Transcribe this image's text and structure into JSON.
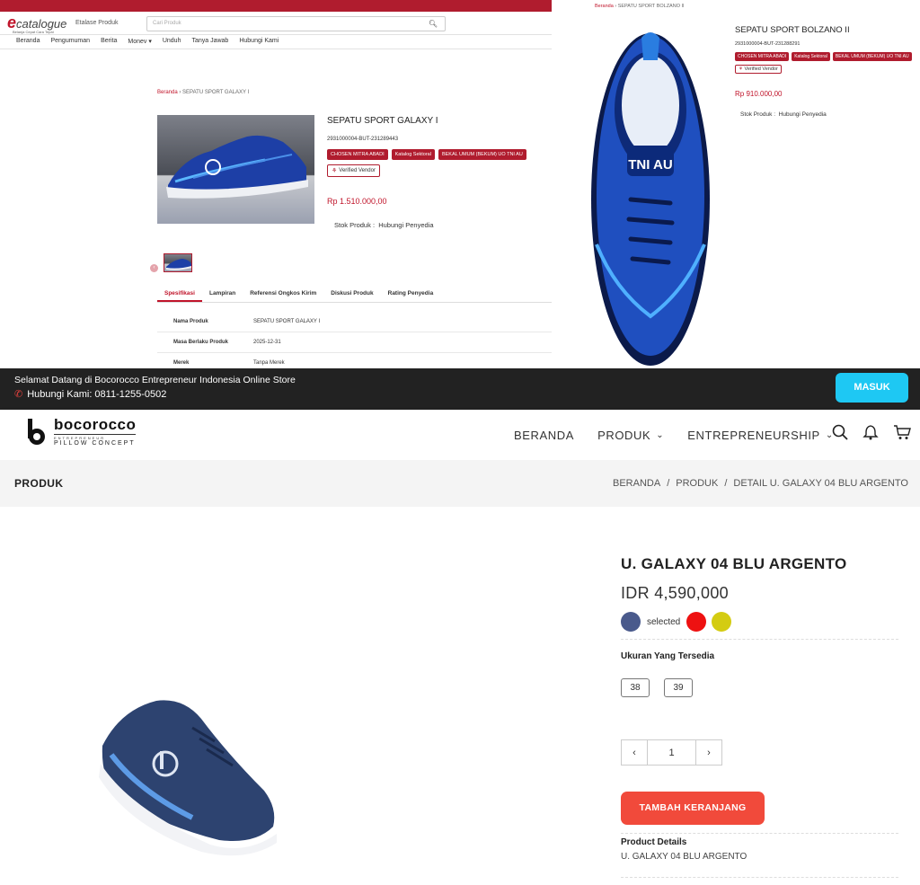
{
  "ecatalogue": {
    "logo": {
      "e": "e",
      "text": "catalogue",
      "sub": "Belanja Cepat Cara Tepat"
    },
    "etalase_label": "Etalase Produk",
    "search_placeholder": "Cari Produk",
    "nav": [
      "Beranda",
      "Pengumuman",
      "Berita",
      "Monev ▾",
      "Unduh",
      "Tanya Jawab",
      "Hubungi Kami"
    ],
    "breadcrumb": {
      "home": "Beranda",
      "sep": "›",
      "current": "SEPATU SPORT GALAXY I"
    },
    "product": {
      "title": "SEPATU SPORT GALAXY I",
      "sku": "2931000004-BUT-231289443",
      "badges": [
        "CHOSEN MITRA ABADI",
        "Katalog Sektoral",
        "BEKAL UMUM (BEKUM) UO TNI AU"
      ],
      "verified": "Verified Vendor",
      "price": "Rp 1.510.000,00",
      "stock_label": "Stok Produk :",
      "stock_value": "Hubungi Penyedia"
    },
    "tabs": [
      "Spesifikasi",
      "Lampiran",
      "Referensi Ongkos Kirim",
      "Diskusi Produk",
      "Rating Penyedia"
    ],
    "specs": [
      {
        "k": "Nama Produk",
        "v": "SEPATU SPORT GALAXY I"
      },
      {
        "k": "Masa Berlaku Produk",
        "v": "2025-12-31"
      },
      {
        "k": "Merek",
        "v": "Tanpa Merek"
      }
    ]
  },
  "bolzano": {
    "breadcrumb": {
      "home": "Beranda",
      "sep": "›",
      "current": "SEPATU SPORT BOLZANO II"
    },
    "title": "SEPATU SPORT BOLZANO II",
    "sku": "2931000004-BUT-231288291",
    "badges": [
      "CHOSEN MITRA ABADI",
      "Katalog Sektoral",
      "BEKAL UMUM (BEKUM) UO TNI AU"
    ],
    "verified": "Verified Vendor",
    "price": "Rp 910.000,00",
    "stock_label": "Stok Produk :",
    "stock_value": "Hubungi Penyedia",
    "shoe_print": "TNI AU"
  },
  "bocorocco": {
    "welcome": "Selamat Datang di Bocorocco Entrepreneur Indonesia Online Store",
    "phone": "Hubungi Kami: 0811-1255-0502",
    "login": "MASUK",
    "brand": {
      "name": "bocorocco",
      "tag1": "ENTREPRENEUR",
      "tag2": "PILLOW CONCEPT"
    },
    "nav": [
      "BERANDA",
      "PRODUK",
      "ENTREPRENEURSHIP"
    ],
    "page_title": "PRODUK",
    "breadcrumb": [
      "BERANDA",
      "PRODUK",
      "DETAIL U. GALAXY 04 BLU ARGENTO"
    ],
    "product": {
      "title": "U. GALAXY 04 BLU ARGENTO",
      "price": "IDR 4,590,000",
      "selected_label": "selected",
      "colors": [
        "#4a5a8c",
        "#ee1111",
        "#d4cc12"
      ],
      "sizes_label": "Ukuran Yang Tersedia",
      "sizes": [
        "38",
        "39"
      ],
      "quantity": "1",
      "add_to_cart": "TAMBAH KERANJANG",
      "details_label": "Product Details",
      "details_value": "U. GALAXY 04 BLU ARGENTO"
    }
  }
}
